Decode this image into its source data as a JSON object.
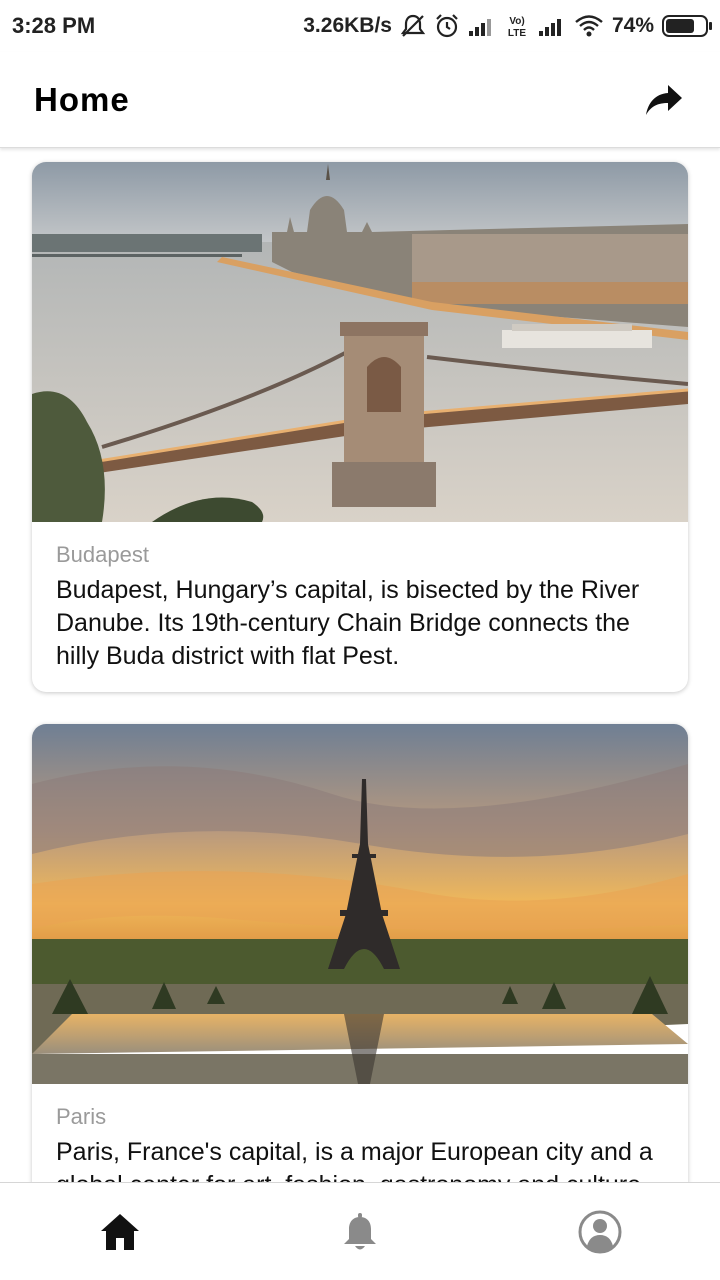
{
  "status_bar": {
    "time": "3:28 PM",
    "network_speed": "3.26KB/s",
    "battery_percent": "74%",
    "battery_level": 0.74,
    "icons": [
      "mute-icon",
      "alarm-icon",
      "signal-icon",
      "volte-icon",
      "signal-icon",
      "wifi-icon",
      "battery-icon"
    ]
  },
  "app_bar": {
    "title": "Home",
    "action_icon": "share-icon"
  },
  "cards": [
    {
      "subtitle": "Budapest",
      "text": "Budapest, Hungary’s capital, is bisected by the River Danube. Its 19th-century Chain Bridge connects the hilly Buda district with flat Pest.",
      "image": "budapest-chain-bridge-photo"
    },
    {
      "subtitle": "Paris",
      "text": "Paris, France's capital, is a major European city and a global center for art, fashion, gastronomy and culture.",
      "image": "paris-eiffel-tower-photo"
    }
  ],
  "bottom_nav": {
    "items": [
      {
        "icon": "home-icon",
        "active": true
      },
      {
        "icon": "bell-icon",
        "active": false
      },
      {
        "icon": "profile-icon",
        "active": false
      }
    ],
    "active_color": "#111111",
    "inactive_color": "#8a8a8a"
  }
}
